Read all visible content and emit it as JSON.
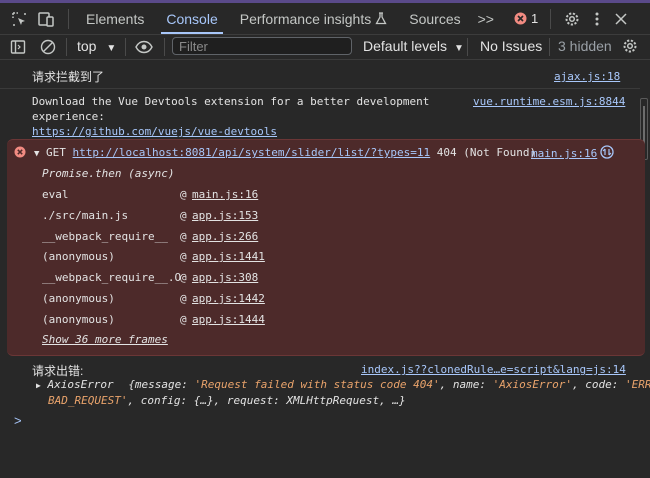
{
  "tabs": {
    "elements": "Elements",
    "console": "Console",
    "performance_insights": "Performance insights",
    "sources": "Sources",
    "more": ">>",
    "error_count": "1"
  },
  "toolbar": {
    "context": "top",
    "filter_placeholder": "Filter",
    "levels": "Default levels",
    "issues": "No Issues",
    "hidden": "3 hidden"
  },
  "console": {
    "msg1": {
      "text": "请求拦截到了",
      "source": "ajax.js:18"
    },
    "msg2": {
      "text_line1": "Download the Vue Devtools extension for a better development",
      "text_line2": "experience:",
      "url": "https://github.com/vuejs/vue-devtools",
      "source": "vue.runtime.esm.js:8844"
    },
    "error": {
      "method": "GET",
      "url": "http://localhost:8081/api/system/slider/list/?types=11",
      "status": "404 (Not Found)",
      "source": "main.js:16",
      "promise": "Promise.then (async)",
      "frames": [
        {
          "fn": "eval",
          "at": "@",
          "loc": "main.js:16"
        },
        {
          "fn": "./src/main.js",
          "at": "@",
          "loc": "app.js:153"
        },
        {
          "fn": "__webpack_require__",
          "at": "@",
          "loc": "app.js:266"
        },
        {
          "fn": "(anonymous)",
          "at": "@",
          "loc": "app.js:1441"
        },
        {
          "fn": "__webpack_require__.O",
          "at": "@",
          "loc": "app.js:308"
        },
        {
          "fn": "(anonymous)",
          "at": "@",
          "loc": "app.js:1442"
        },
        {
          "fn": "(anonymous)",
          "at": "@",
          "loc": "app.js:1444"
        }
      ],
      "show_more": "Show 36 more frames"
    },
    "msg3": {
      "text": "请求出错:",
      "source": "index.js??clonedRule…e=script&lang=js:14",
      "obj_name": "AxiosError",
      "obj_line1_a": "{message: ",
      "obj_line1_b": "'Request failed with status code 404'",
      "obj_line1_c": ", name: ",
      "obj_line1_d": "'AxiosError'",
      "obj_line1_e": ", code: ",
      "obj_line1_f": "'ERR_",
      "obj_line2_a": "BAD_REQUEST'",
      "obj_line2_b": ", config: {…}, request: XMLHttpRequest,  …}"
    },
    "prompt": ">"
  },
  "colors": {
    "accent": "#a8c7fa",
    "error_bg": "#4d2a2a",
    "error_icon": "#f28b82",
    "background": "#282828"
  }
}
